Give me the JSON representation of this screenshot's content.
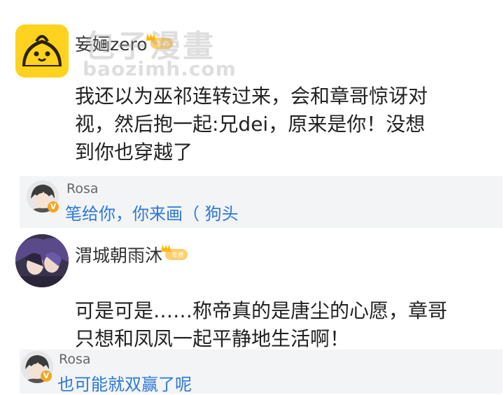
{
  "watermark": {
    "line1": "包子漫畫",
    "line2": "baozimh.com"
  },
  "comments": [
    {
      "username": "妄婳zero",
      "badge": "年费",
      "body": "我还以为巫祁连转过来，会和章哥惊讶对\n视，然后抱一起:兄dei，原来是你！没想\n到你也穿越了",
      "reply": {
        "username": "Rosa",
        "text": "笔给你，你来画（ 狗头",
        "verified_mark": "V"
      }
    },
    {
      "username": "渭城朝雨沐",
      "badge": "年费",
      "body": "可是可是……称帝真的是唐尘的心愿，章哥\n只想和凤凤一起平静地生活啊！",
      "reply": {
        "username": "Rosa",
        "text": "也可能就双赢了呢",
        "verified_mark": "V"
      }
    }
  ],
  "colors": {
    "reply_link": "#2b78d8",
    "reply_bg": "#f3f4f6",
    "bun_avatar_bg": "#ffd21f",
    "vip_gold": "#ffb800"
  },
  "icons": {
    "avatar1": "steamed-bun-icon",
    "crown": "crown-icon",
    "verified": "verified-v-icon"
  }
}
